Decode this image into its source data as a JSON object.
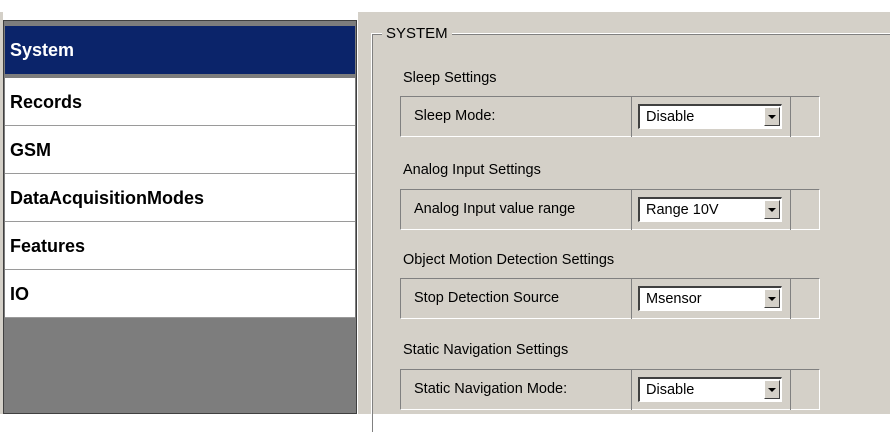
{
  "sidebar": {
    "items": [
      {
        "label": "System",
        "selected": true
      },
      {
        "label": "Records",
        "selected": false
      },
      {
        "label": "GSM",
        "selected": false
      },
      {
        "label": "DataAcquisitionModes",
        "selected": false
      },
      {
        "label": "Features",
        "selected": false
      },
      {
        "label": "IO",
        "selected": false
      }
    ]
  },
  "group": {
    "title": "SYSTEM",
    "sections": [
      {
        "heading": "Sleep Settings",
        "label": "Sleep Mode:",
        "value": "Disable"
      },
      {
        "heading": "Analog Input Settings",
        "label": "Analog Input value range",
        "value": "Range 10V"
      },
      {
        "heading": "Object Motion Detection Settings",
        "label": "Stop Detection Source",
        "value": "Msensor"
      },
      {
        "heading": "Static Navigation Settings",
        "label": "Static Navigation Mode:",
        "value": "Disable"
      }
    ]
  },
  "colors": {
    "selected_bg": "#0b246a",
    "panel_bg": "#d4d0c8",
    "sidebar_empty_bg": "#7d7d7d"
  },
  "icons": {
    "dropdown": "chevron-down-icon"
  }
}
